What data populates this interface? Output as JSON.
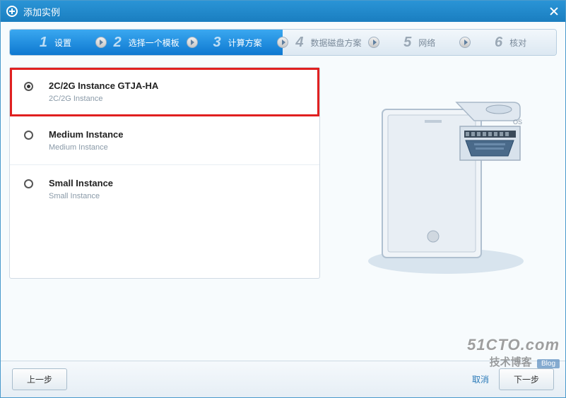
{
  "dialog": {
    "title": "添加实例"
  },
  "steps": [
    {
      "num": "1",
      "label": "设置",
      "active": true
    },
    {
      "num": "2",
      "label": "选择一个模板",
      "active": true
    },
    {
      "num": "3",
      "label": "计算方案",
      "active": true
    },
    {
      "num": "4",
      "label": "数据磁盘方案",
      "active": false
    },
    {
      "num": "5",
      "label": "网络",
      "active": false
    },
    {
      "num": "6",
      "label": "核对",
      "active": false
    }
  ],
  "options": [
    {
      "title": "2C/2G Instance GTJA-HA",
      "sub": "2C/2G Instance",
      "selected": true
    },
    {
      "title": "Medium Instance",
      "sub": "Medium Instance",
      "selected": false
    },
    {
      "title": "Small Instance",
      "sub": "Small Instance",
      "selected": false
    }
  ],
  "illustration": {
    "os_label": "OS"
  },
  "footer": {
    "prev": "上一步",
    "cancel": "取消",
    "next": "下一步"
  },
  "watermark": {
    "line1": "51CTO.com",
    "line2": "技术博客",
    "badge": "Blog"
  }
}
